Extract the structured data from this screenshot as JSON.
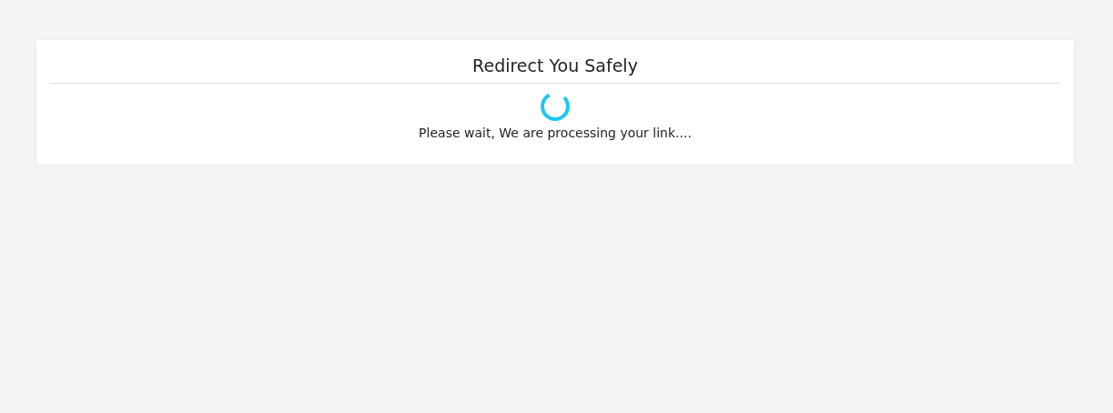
{
  "card": {
    "title": "Redirect You Safely",
    "message": "Please wait, We are processing your link...."
  }
}
